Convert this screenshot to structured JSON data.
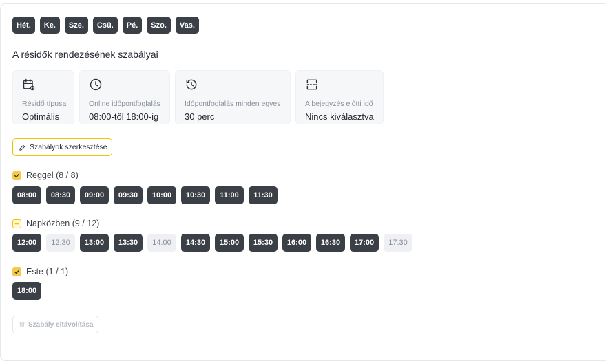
{
  "days": [
    "Hét.",
    "Ke.",
    "Sze.",
    "Csü.",
    "Pé.",
    "Szo.",
    "Vas."
  ],
  "section_title": "A résidők rendezésének szabályai",
  "cards": [
    {
      "icon": "calendar-settings-icon",
      "label": "Résidő típusa",
      "value": "Optimális"
    },
    {
      "icon": "clock-icon",
      "label": "Online időpontfoglalás",
      "value": "08:00-től 18:00-ig"
    },
    {
      "icon": "history-icon",
      "label": "Időpontfoglalás minden egyes",
      "value": "30 perc"
    },
    {
      "icon": "layout-split-icon",
      "label": "A bejegyzés előtti idő",
      "value": "Nincs kiválasztva"
    }
  ],
  "edit_button": {
    "label": "Szabályok szerkesztése",
    "icon": "pencil-icon"
  },
  "groups": [
    {
      "label": "Reggel (8 / 8)",
      "state": "checked",
      "slots": [
        {
          "time": "08:00",
          "active": true
        },
        {
          "time": "08:30",
          "active": true
        },
        {
          "time": "09:00",
          "active": true
        },
        {
          "time": "09:30",
          "active": true
        },
        {
          "time": "10:00",
          "active": true
        },
        {
          "time": "10:30",
          "active": true
        },
        {
          "time": "11:00",
          "active": true
        },
        {
          "time": "11:30",
          "active": true
        }
      ]
    },
    {
      "label": "Napközben (9 / 12)",
      "state": "partial",
      "slots": [
        {
          "time": "12:00",
          "active": true
        },
        {
          "time": "12:30",
          "active": false
        },
        {
          "time": "13:00",
          "active": true
        },
        {
          "time": "13:30",
          "active": true
        },
        {
          "time": "14:00",
          "active": false
        },
        {
          "time": "14:30",
          "active": true
        },
        {
          "time": "15:00",
          "active": true
        },
        {
          "time": "15:30",
          "active": true
        },
        {
          "time": "16:00",
          "active": true
        },
        {
          "time": "16:30",
          "active": true
        },
        {
          "time": "17:00",
          "active": true
        },
        {
          "time": "17:30",
          "active": false
        }
      ]
    },
    {
      "label": "Este (1 / 1)",
      "state": "checked",
      "slots": [
        {
          "time": "18:00",
          "active": true
        }
      ]
    }
  ],
  "remove_button": {
    "label": "Szabály eltávolítása",
    "icon": "trash-icon"
  },
  "colors": {
    "accent": "#f2c500",
    "chip_dark": "#3b3f46",
    "chip_off": "#eef0f4"
  }
}
